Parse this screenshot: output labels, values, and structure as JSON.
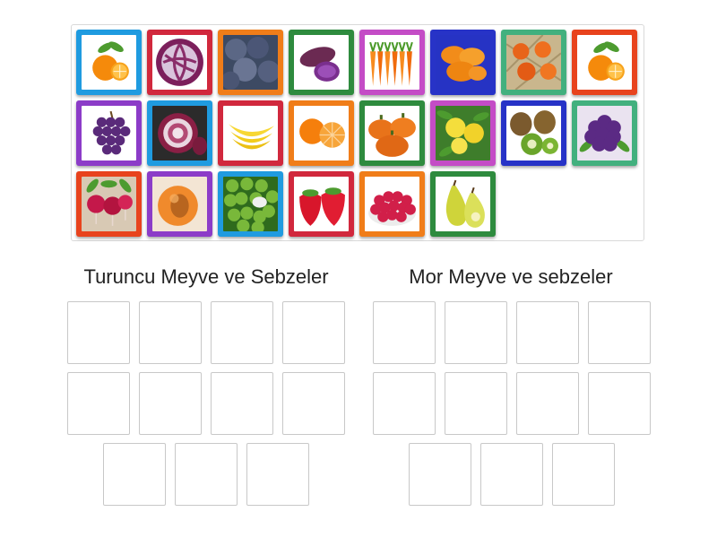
{
  "groups": [
    {
      "title": "Turuncu Meyve ve Sebzeler",
      "slot_count": 11
    },
    {
      "title": "Mor Meyve ve sebzeler",
      "slot_count": 11
    }
  ],
  "cards": [
    {
      "item": "orange",
      "frame_color": "#1f9be0"
    },
    {
      "item": "red-cabbage",
      "frame_color": "#d1283d"
    },
    {
      "item": "plums",
      "frame_color": "#f07d19"
    },
    {
      "item": "purple-sweet-potato",
      "frame_color": "#2e8b3e"
    },
    {
      "item": "carrots",
      "frame_color": "#c44cc6"
    },
    {
      "item": "dried-apricots",
      "frame_color": "#2733c7"
    },
    {
      "item": "tangerines",
      "frame_color": "#42b07e"
    },
    {
      "item": "orange",
      "frame_color": "#e8431d"
    },
    {
      "item": "grapes",
      "frame_color": "#8c3cc8"
    },
    {
      "item": "red-onion",
      "frame_color": "#1f9be0"
    },
    {
      "item": "bananas",
      "frame_color": "#d1283d"
    },
    {
      "item": "mandarin-peeled",
      "frame_color": "#f07d19"
    },
    {
      "item": "pumpkins",
      "frame_color": "#2e8b3e"
    },
    {
      "item": "lemons",
      "frame_color": "#c44cc6"
    },
    {
      "item": "kiwi",
      "frame_color": "#2733c7"
    },
    {
      "item": "purple-cauliflower",
      "frame_color": "#42b07e"
    },
    {
      "item": "radishes",
      "frame_color": "#e8431d"
    },
    {
      "item": "apricot",
      "frame_color": "#8c3cc8"
    },
    {
      "item": "green-peas",
      "frame_color": "#1f9be0"
    },
    {
      "item": "strawberries",
      "frame_color": "#d1283d"
    },
    {
      "item": "raspberries",
      "frame_color": "#f07d19"
    },
    {
      "item": "pears",
      "frame_color": "#2e8b3e"
    }
  ]
}
